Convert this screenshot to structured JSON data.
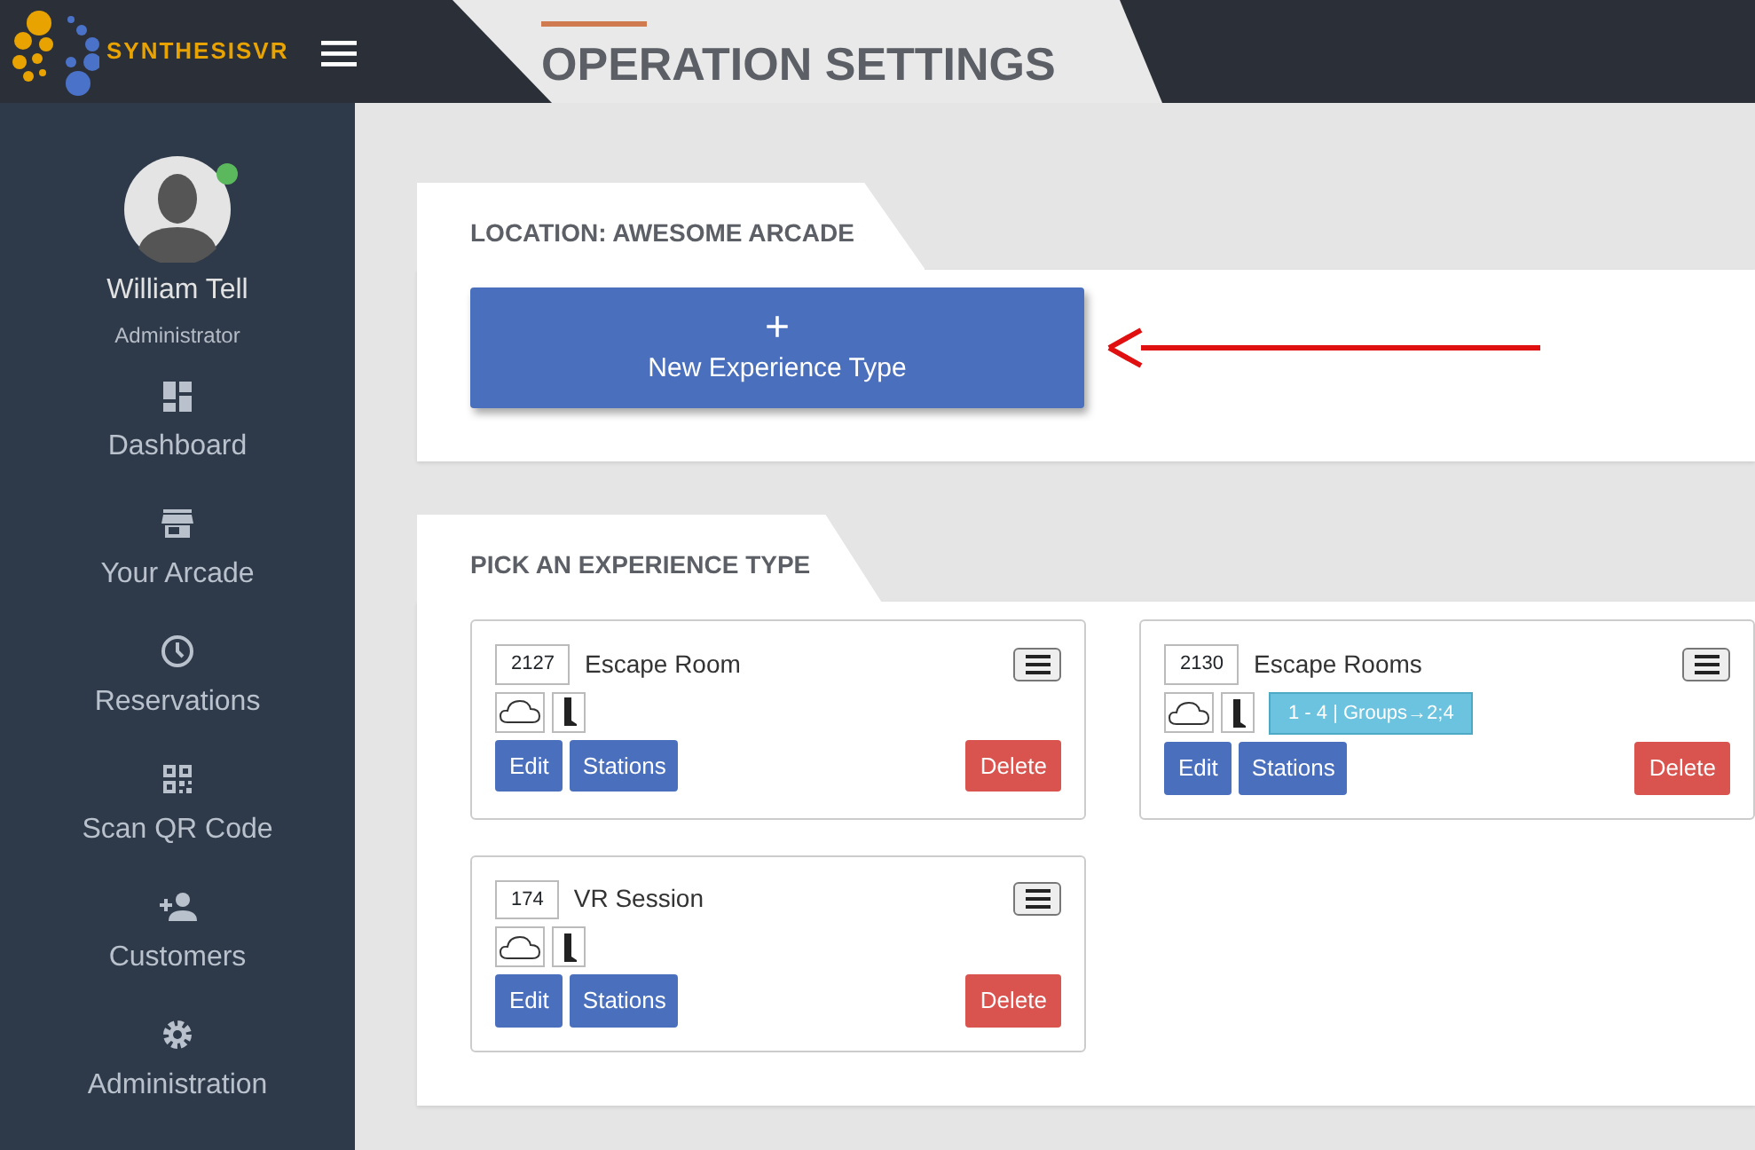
{
  "brand": {
    "name": "SYNTHESISVR"
  },
  "page_title": "OPERATION SETTINGS",
  "user": {
    "name": "William Tell",
    "role": "Administrator",
    "online": true
  },
  "nav": [
    {
      "label": "Dashboard"
    },
    {
      "label": "Your Arcade"
    },
    {
      "label": "Reservations"
    },
    {
      "label": "Scan QR Code"
    },
    {
      "label": "Customers"
    },
    {
      "label": "Administration"
    }
  ],
  "location_panel": {
    "title": "LOCATION: AWESOME ARCADE",
    "new_button": {
      "icon": "+",
      "label": "New Experience Type"
    }
  },
  "experience_panel": {
    "title": "PICK AN EXPERIENCE TYPE",
    "experiences": [
      {
        "id": "2127",
        "name": "Escape Room",
        "buttons": [
          "Edit",
          "Stations",
          "Delete"
        ]
      },
      {
        "id": "2130",
        "name": "Escape Rooms",
        "badge": "1 - 4 | Groups→2;4",
        "buttons": [
          "Edit",
          "Stations",
          "Delete"
        ]
      },
      {
        "id": "174",
        "name": "VR Session",
        "buttons": [
          "Edit",
          "Stations",
          "Delete"
        ]
      }
    ]
  }
}
